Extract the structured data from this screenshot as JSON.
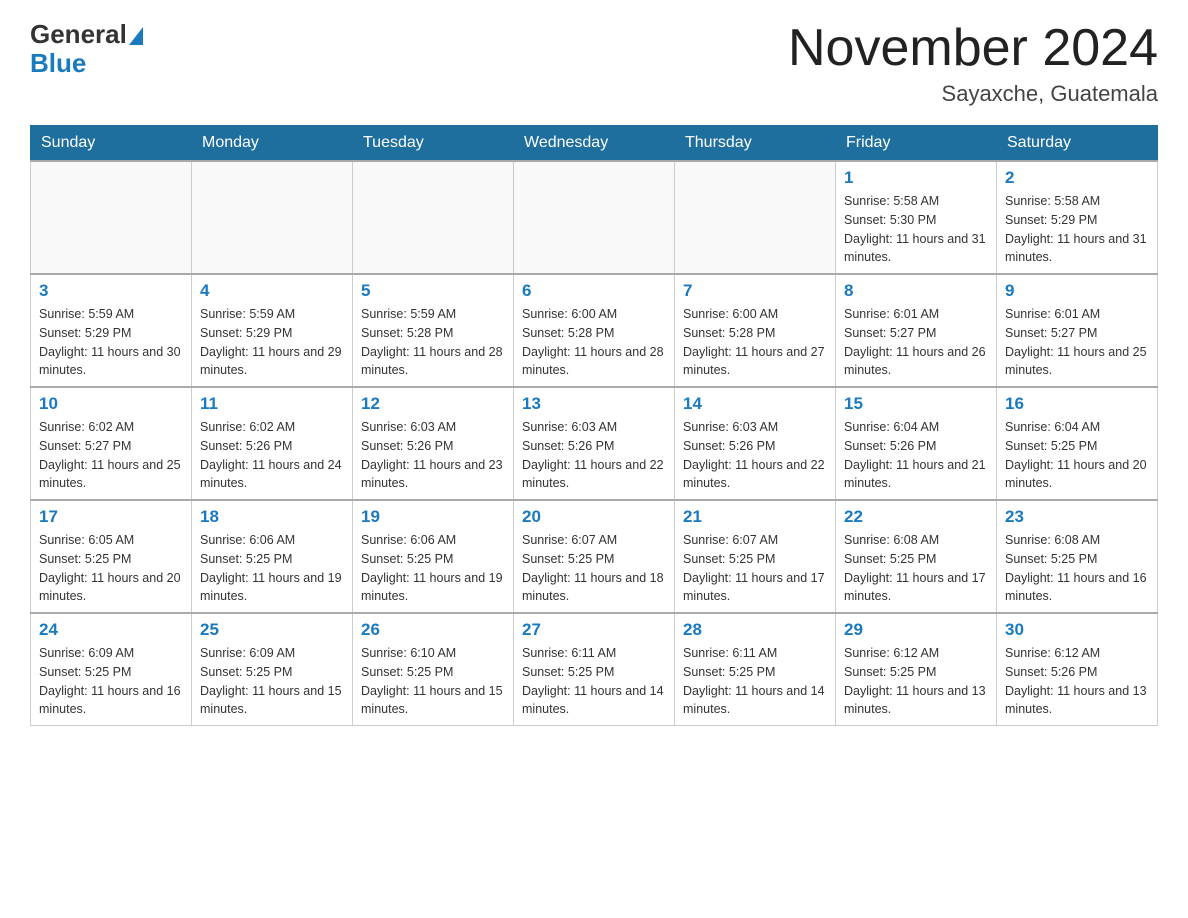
{
  "header": {
    "logo_general": "General",
    "logo_blue": "Blue",
    "month_title": "November 2024",
    "location": "Sayaxche, Guatemala"
  },
  "days_of_week": [
    "Sunday",
    "Monday",
    "Tuesday",
    "Wednesday",
    "Thursday",
    "Friday",
    "Saturday"
  ],
  "weeks": [
    [
      {
        "day": "",
        "info": ""
      },
      {
        "day": "",
        "info": ""
      },
      {
        "day": "",
        "info": ""
      },
      {
        "day": "",
        "info": ""
      },
      {
        "day": "",
        "info": ""
      },
      {
        "day": "1",
        "info": "Sunrise: 5:58 AM\nSunset: 5:30 PM\nDaylight: 11 hours and 31 minutes."
      },
      {
        "day": "2",
        "info": "Sunrise: 5:58 AM\nSunset: 5:29 PM\nDaylight: 11 hours and 31 minutes."
      }
    ],
    [
      {
        "day": "3",
        "info": "Sunrise: 5:59 AM\nSunset: 5:29 PM\nDaylight: 11 hours and 30 minutes."
      },
      {
        "day": "4",
        "info": "Sunrise: 5:59 AM\nSunset: 5:29 PM\nDaylight: 11 hours and 29 minutes."
      },
      {
        "day": "5",
        "info": "Sunrise: 5:59 AM\nSunset: 5:28 PM\nDaylight: 11 hours and 28 minutes."
      },
      {
        "day": "6",
        "info": "Sunrise: 6:00 AM\nSunset: 5:28 PM\nDaylight: 11 hours and 28 minutes."
      },
      {
        "day": "7",
        "info": "Sunrise: 6:00 AM\nSunset: 5:28 PM\nDaylight: 11 hours and 27 minutes."
      },
      {
        "day": "8",
        "info": "Sunrise: 6:01 AM\nSunset: 5:27 PM\nDaylight: 11 hours and 26 minutes."
      },
      {
        "day": "9",
        "info": "Sunrise: 6:01 AM\nSunset: 5:27 PM\nDaylight: 11 hours and 25 minutes."
      }
    ],
    [
      {
        "day": "10",
        "info": "Sunrise: 6:02 AM\nSunset: 5:27 PM\nDaylight: 11 hours and 25 minutes."
      },
      {
        "day": "11",
        "info": "Sunrise: 6:02 AM\nSunset: 5:26 PM\nDaylight: 11 hours and 24 minutes."
      },
      {
        "day": "12",
        "info": "Sunrise: 6:03 AM\nSunset: 5:26 PM\nDaylight: 11 hours and 23 minutes."
      },
      {
        "day": "13",
        "info": "Sunrise: 6:03 AM\nSunset: 5:26 PM\nDaylight: 11 hours and 22 minutes."
      },
      {
        "day": "14",
        "info": "Sunrise: 6:03 AM\nSunset: 5:26 PM\nDaylight: 11 hours and 22 minutes."
      },
      {
        "day": "15",
        "info": "Sunrise: 6:04 AM\nSunset: 5:26 PM\nDaylight: 11 hours and 21 minutes."
      },
      {
        "day": "16",
        "info": "Sunrise: 6:04 AM\nSunset: 5:25 PM\nDaylight: 11 hours and 20 minutes."
      }
    ],
    [
      {
        "day": "17",
        "info": "Sunrise: 6:05 AM\nSunset: 5:25 PM\nDaylight: 11 hours and 20 minutes."
      },
      {
        "day": "18",
        "info": "Sunrise: 6:06 AM\nSunset: 5:25 PM\nDaylight: 11 hours and 19 minutes."
      },
      {
        "day": "19",
        "info": "Sunrise: 6:06 AM\nSunset: 5:25 PM\nDaylight: 11 hours and 19 minutes."
      },
      {
        "day": "20",
        "info": "Sunrise: 6:07 AM\nSunset: 5:25 PM\nDaylight: 11 hours and 18 minutes."
      },
      {
        "day": "21",
        "info": "Sunrise: 6:07 AM\nSunset: 5:25 PM\nDaylight: 11 hours and 17 minutes."
      },
      {
        "day": "22",
        "info": "Sunrise: 6:08 AM\nSunset: 5:25 PM\nDaylight: 11 hours and 17 minutes."
      },
      {
        "day": "23",
        "info": "Sunrise: 6:08 AM\nSunset: 5:25 PM\nDaylight: 11 hours and 16 minutes."
      }
    ],
    [
      {
        "day": "24",
        "info": "Sunrise: 6:09 AM\nSunset: 5:25 PM\nDaylight: 11 hours and 16 minutes."
      },
      {
        "day": "25",
        "info": "Sunrise: 6:09 AM\nSunset: 5:25 PM\nDaylight: 11 hours and 15 minutes."
      },
      {
        "day": "26",
        "info": "Sunrise: 6:10 AM\nSunset: 5:25 PM\nDaylight: 11 hours and 15 minutes."
      },
      {
        "day": "27",
        "info": "Sunrise: 6:11 AM\nSunset: 5:25 PM\nDaylight: 11 hours and 14 minutes."
      },
      {
        "day": "28",
        "info": "Sunrise: 6:11 AM\nSunset: 5:25 PM\nDaylight: 11 hours and 14 minutes."
      },
      {
        "day": "29",
        "info": "Sunrise: 6:12 AM\nSunset: 5:25 PM\nDaylight: 11 hours and 13 minutes."
      },
      {
        "day": "30",
        "info": "Sunrise: 6:12 AM\nSunset: 5:26 PM\nDaylight: 11 hours and 13 minutes."
      }
    ]
  ]
}
